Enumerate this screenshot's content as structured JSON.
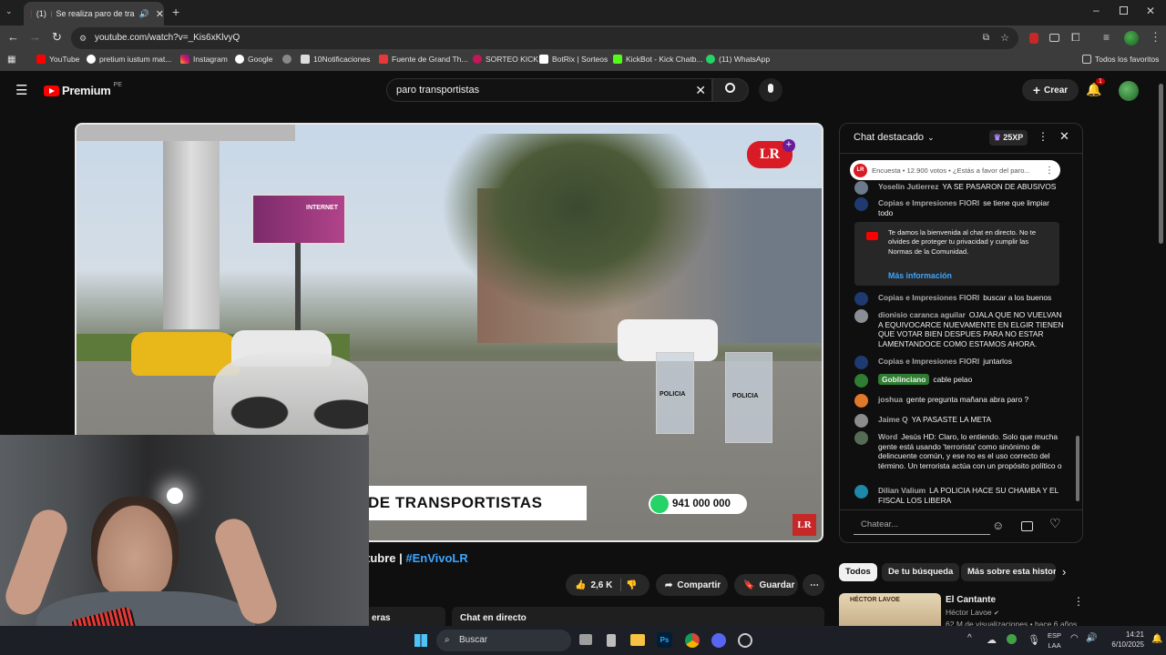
{
  "browser": {
    "tab_count": "(1)",
    "tab_title": "Se realiza paro de tra",
    "url": "youtube.com/watch?v=_Kis6xKlvyQ",
    "bookmarks": [
      "YouTube",
      "pretium iustum mat...",
      "Instagram",
      "Google",
      "10Notificaciones",
      "Fuente de Grand Th...",
      "SORTEO KICK",
      "BotRix | Sorteos",
      "KickBot - Kick Chatb...",
      "(11) WhatsApp"
    ],
    "all_favorites": "Todos los favoritos"
  },
  "header": {
    "logo": "Premium",
    "region": "PE",
    "search_value": "paro transportistas",
    "create_label": "Crear",
    "notif_count": "1"
  },
  "video": {
    "banner_text": "DE TRANSPORTISTAS",
    "phone": "941 000 000",
    "logo": "LR",
    "sign_text": "INTERNET",
    "police_text": "POLICIA"
  },
  "below_video": {
    "title_tail": "tubre | ",
    "hashtag": "#EnVivoLR",
    "likes": "2,6 K",
    "share": "Compartir",
    "save": "Guardar",
    "section_chat": "Chat en directo",
    "section_left": "eras"
  },
  "chat": {
    "header": "Chat destacado",
    "xp": "25XP",
    "poll": "Encuesta • 12.900 votos • ¿Estás a favor del paro...",
    "welcome": "Te damos la bienvenida al chat en directo. No te olvides de proteger tu privacidad y cumplir las Normas de la Comunidad.",
    "more_info": "Más información",
    "input_placeholder": "Chatear...",
    "messages": [
      {
        "author": "Yoselin Jutierrez",
        "text": "YA SE PASARON DE ABUSIVOS",
        "color": "#6b7b8c"
      },
      {
        "author": "Copias e Impresiones FIORI",
        "text": "se tiene que limpiar todo",
        "color": "#1f3a70"
      },
      {
        "author": "Copias e Impresiones FIORI",
        "text": "buscar a los buenos",
        "color": "#1f3a70"
      },
      {
        "author": "dionisio caranca aguilar",
        "text": "OJALA QUE NO VUELVAN A EQUIVOCARCE NUEVAMENTE EN ELGIR TIENEN QUE VOTAR BIEN DESPUES PARA NO ESTAR LAMENTANDOCE COMO ESTAMOS AHORA.",
        "color": "#8a8f96"
      },
      {
        "author": "Copias e Impresiones FIORI",
        "text": "juntarlos",
        "color": "#1f3a70"
      },
      {
        "author": "Goblinciano",
        "text": "cable pelao",
        "color": "#2e7d32"
      },
      {
        "author": "joshua",
        "text": "gente pregunta mañana abra paro ?",
        "color": "#e0792a"
      },
      {
        "author": "Jaime Q",
        "text": "YA PASASTE LA META",
        "color": "#8c8c8c"
      },
      {
        "author": "Word",
        "text": "Jesús HD: Claro, lo entiendo. Solo que mucha gente está usando 'terrorista' como sinónimo de delincuente común, y ese no es el uso correcto del término. Un terrorista actúa con un propósito político o",
        "color": "#556b55"
      },
      {
        "author": "Dilian Valium",
        "text": "LA POLICIA HACE SU CHAMBA Y EL FISCAL LOS LIBERA",
        "color": "#1e88a8"
      }
    ]
  },
  "filters": [
    "Todos",
    "De tu búsqueda",
    "Más sobre esta histor"
  ],
  "recommendation": {
    "title": "El Cantante",
    "channel": "Héctor Lavoe",
    "meta": "62 M de visualizaciones • hace 6 años",
    "thumb_text": "HÉCTOR LAVOE"
  },
  "taskbar": {
    "search": "Buscar",
    "lang": "ESP",
    "lang2": "LAA",
    "time": "14:21",
    "date": "6/10/2025"
  }
}
